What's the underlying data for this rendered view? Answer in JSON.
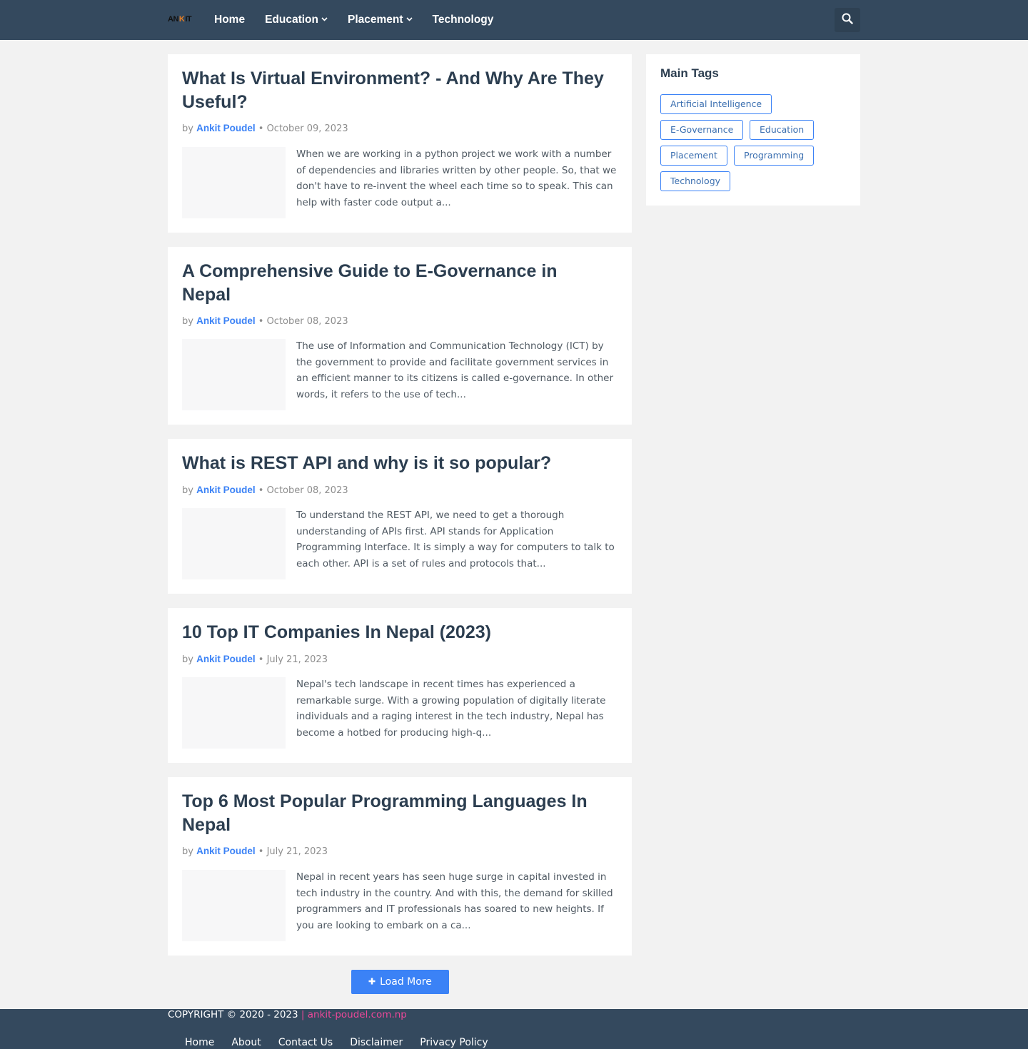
{
  "header": {
    "logo_text_1": "AN",
    "logo_text_2": "K",
    "logo_text_3": "IT",
    "nav": [
      {
        "label": "Home"
      },
      {
        "label": "Education"
      },
      {
        "label": "Placement"
      },
      {
        "label": "Technology"
      }
    ],
    "search_icon": "search-icon"
  },
  "posts": [
    {
      "title": "What Is Virtual Environment? - And Why Are They Useful?",
      "by": "by",
      "author": "Ankit Poudel",
      "separator": "•",
      "date": "October 09, 2023",
      "snippet": "When we are working in a python project we work with a number of dependencies and libraries written by other people. So, that we don't have to re-invent the wheel each time so to speak. This can help with faster code output a..."
    },
    {
      "title": "A Comprehensive Guide to E-Governance in Nepal",
      "by": "by",
      "author": "Ankit Poudel",
      "separator": "•",
      "date": "October 08, 2023",
      "snippet": "The use of Information and Communication Technology (ICT) by the government to provide and facilitate government services in an efficient manner to its citizens is called e-governance. In other words, it refers to the use of tech..."
    },
    {
      "title": "What is REST API and why is it so popular?",
      "by": "by",
      "author": "Ankit Poudel",
      "separator": "•",
      "date": "October 08, 2023",
      "snippet": "To understand the REST API, we need to get a thorough understanding of APIs first. API stands for Application Programming Interface. It is simply a way for computers to talk to each other. API is a set of rules and protocols that..."
    },
    {
      "title": "10 Top IT Companies In Nepal (2023)",
      "by": "by",
      "author": "Ankit Poudel",
      "separator": "•",
      "date": "July 21, 2023",
      "snippet": "Nepal's tech landscape in recent times has experienced a remarkable surge. With a growing population of digitally literate individuals and a raging interest in the tech industry, Nepal has become a hotbed for producing high-q..."
    },
    {
      "title": "Top 6 Most Popular Programming Languages In Nepal",
      "by": "by",
      "author": "Ankit Poudel",
      "separator": "•",
      "date": "July 21, 2023",
      "snippet": "Nepal in recent years has seen huge surge in capital invested in tech industry in the country. And with this, the demand for skilled programmers and IT professionals has soared to new heights. If you are looking to embark on a ca..."
    }
  ],
  "sidebar": {
    "title": "Main Tags",
    "tags": [
      {
        "label": "Artificial Intelligence"
      },
      {
        "label": "E-Governance"
      },
      {
        "label": "Education"
      },
      {
        "label": "Placement"
      },
      {
        "label": "Programming"
      },
      {
        "label": "Technology"
      }
    ]
  },
  "load_more": {
    "icon": "plus-icon",
    "label": "Load More"
  },
  "footer": {
    "copyright": "COPYRIGHT © 2020 - 2023",
    "site": "| ankit-poudel.com.np",
    "links": [
      {
        "label": "Home"
      },
      {
        "label": "About"
      },
      {
        "label": "Contact Us"
      },
      {
        "label": "Disclaimer"
      },
      {
        "label": "Privacy Policy"
      }
    ]
  },
  "colors": {
    "header_bg": "#34495e",
    "accent": "#3b82f6",
    "footer_site": "#ec4899",
    "page_bg": "#f2f2f2"
  }
}
